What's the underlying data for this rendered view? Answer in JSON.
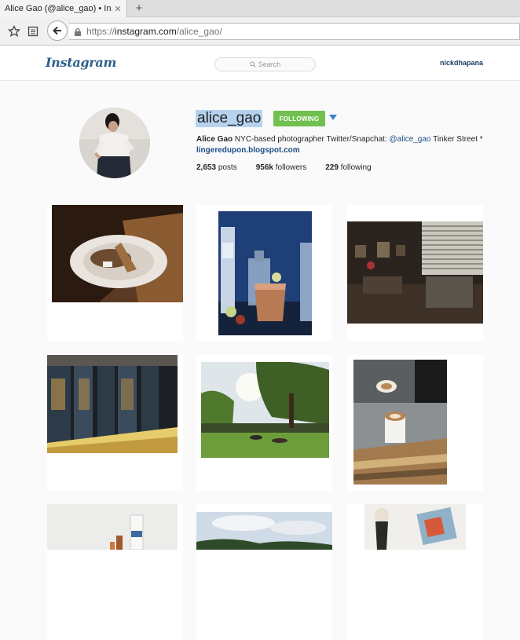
{
  "browser": {
    "tab_title": "Alice Gao (@alice_gao) • In...",
    "tab_close": "✕",
    "new_tab": "+",
    "url_scheme": "https://",
    "url_host": "instagram.com",
    "url_path": "/alice_gao/"
  },
  "header": {
    "logo": "Instagram",
    "search_placeholder": "Search",
    "current_user": "nickdhapana"
  },
  "profile": {
    "username": "alice_gao",
    "follow_label": "FOLLOWING",
    "bio_name": "Alice Gao",
    "bio_text": "NYC-based photographer Twitter/Snapchat: ",
    "bio_mention": "@alice_gao",
    "bio_tail": " Tinker Street *",
    "website": "lingeredupon.blogspot.com",
    "posts_count": "2,653",
    "posts_label": "posts",
    "followers_count": "956k",
    "followers_label": "followers",
    "following_count": "229",
    "following_label": "following"
  },
  "colors": {
    "follow_green": "#70c050",
    "link_blue": "#1b4f85",
    "selection": "#b6d2ef"
  }
}
